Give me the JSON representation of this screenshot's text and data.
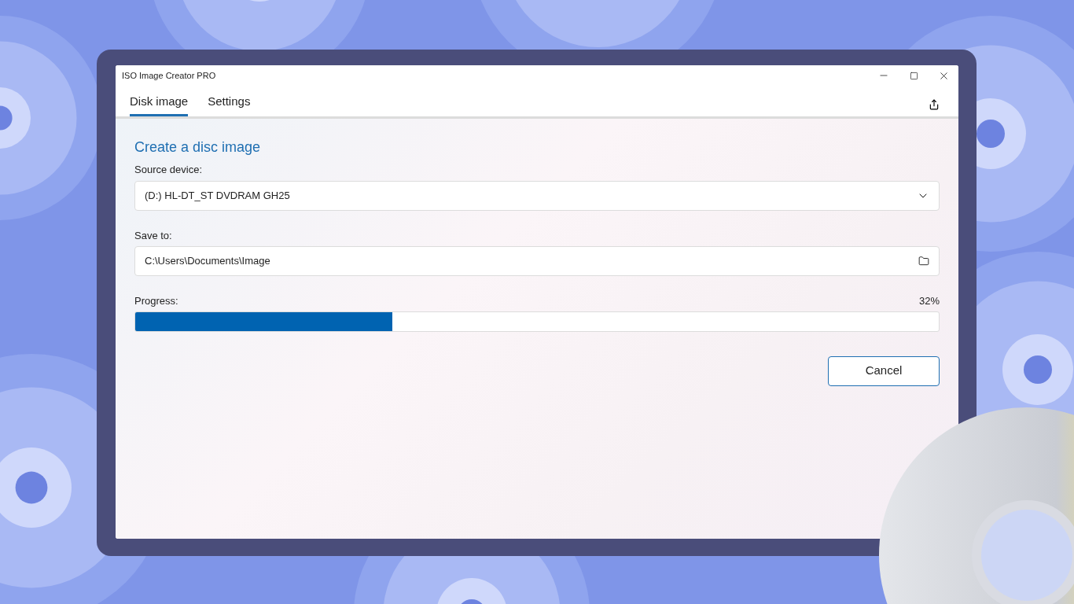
{
  "window": {
    "title": "ISO Image Creator PRO"
  },
  "tabs": [
    {
      "label": "Disk image",
      "selected": true
    },
    {
      "label": "Settings",
      "selected": false
    }
  ],
  "heading": "Create a disc image",
  "source_device": {
    "label": "Source device:",
    "value": "(D:) HL-DT_ST DVDRAM GH25"
  },
  "save_to": {
    "label": "Save to:",
    "value": "C:\\Users\\Documents\\Image"
  },
  "progress": {
    "label": "Progress:",
    "reading": "32%",
    "level": 0.32
  },
  "buttons": [
    "Cancel"
  ]
}
